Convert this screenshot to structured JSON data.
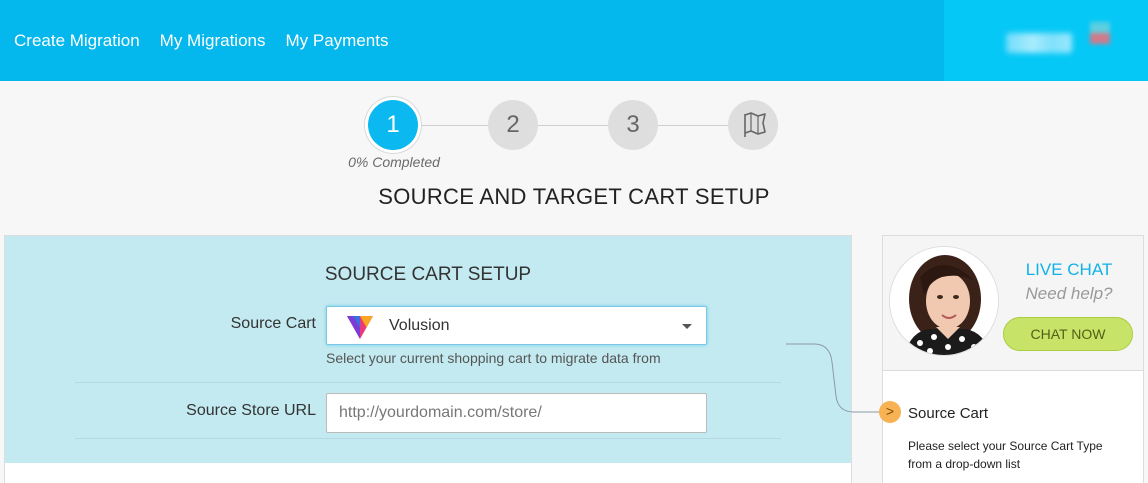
{
  "nav": {
    "items": [
      "Create Migration",
      "My Migrations",
      "My Payments"
    ]
  },
  "steps": {
    "items": [
      "1",
      "2",
      "3"
    ],
    "final_icon": "flag-icon",
    "progress_text": "0% Completed",
    "progress": 0
  },
  "page_title": "SOURCE AND TARGET CART SETUP",
  "source_setup": {
    "title": "SOURCE CART SETUP",
    "cart_label": "Source Cart",
    "cart_value": "Volusion",
    "cart_help": "Select your current shopping cart to migrate data from",
    "url_label": "Source Store URL",
    "url_placeholder": "http://yourdomain.com/store/",
    "url_value": ""
  },
  "chat": {
    "title": "LIVE CHAT",
    "subtitle": "Need help?",
    "button": "CHAT NOW"
  },
  "tip": {
    "bullet": ">",
    "title": "Source Cart",
    "text": "Please select your Source Cart Type from a drop-down list"
  },
  "colors": {
    "header": "#04b7ec",
    "active_step": "#0bb8ef",
    "panel_bg": "#c3eaf0",
    "chat_button": "#c7e368",
    "tip_bullet": "#f7b253"
  }
}
